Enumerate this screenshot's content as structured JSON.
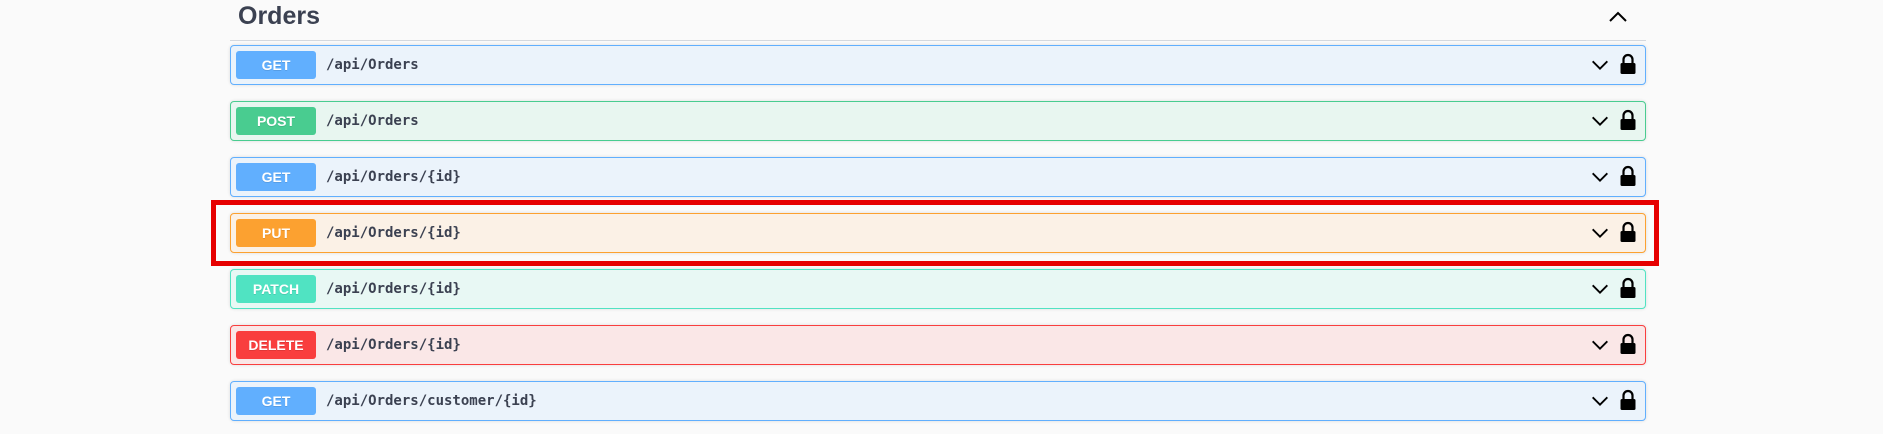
{
  "section": {
    "title": "Orders"
  },
  "operations": [
    {
      "method": "GET",
      "path": "/api/Orders"
    },
    {
      "method": "POST",
      "path": "/api/Orders"
    },
    {
      "method": "GET",
      "path": "/api/Orders/{id}"
    },
    {
      "method": "PUT",
      "path": "/api/Orders/{id}"
    },
    {
      "method": "PATCH",
      "path": "/api/Orders/{id}"
    },
    {
      "method": "DELETE",
      "path": "/api/Orders/{id}"
    },
    {
      "method": "GET",
      "path": "/api/Orders/customer/{id}"
    }
  ],
  "highlighted_operation": 3,
  "colors": {
    "get": "#61affe",
    "post": "#49cc90",
    "put": "#fca130",
    "patch": "#50e3c2",
    "delete": "#f93e3e",
    "highlight": "#e60000"
  },
  "icons": {
    "section_toggle": "chevron-up-icon",
    "expand": "chevron-down-icon",
    "auth": "lock-icon"
  }
}
